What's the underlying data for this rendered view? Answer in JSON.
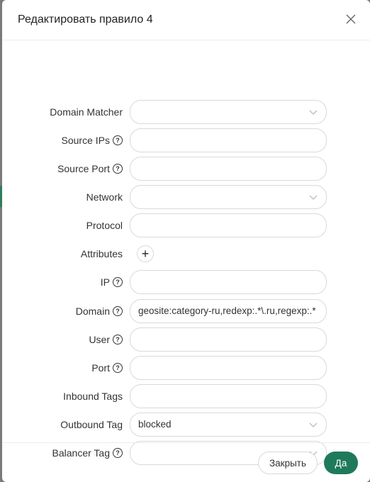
{
  "dialog": {
    "title": "Редактировать правило 4"
  },
  "fields": {
    "domain_matcher": {
      "label": "Domain Matcher",
      "value": ""
    },
    "source_ips": {
      "label": "Source IPs",
      "value": ""
    },
    "source_port": {
      "label": "Source Port",
      "value": ""
    },
    "network": {
      "label": "Network",
      "value": ""
    },
    "protocol": {
      "label": "Protocol",
      "value": ""
    },
    "attributes": {
      "label": "Attributes",
      "add_symbol": "+"
    },
    "ip": {
      "label": "IP",
      "value": ""
    },
    "domain": {
      "label": "Domain",
      "value": "geosite:category-ru,redexp:.*\\.ru,regexp:.*"
    },
    "user": {
      "label": "User",
      "value": ""
    },
    "port": {
      "label": "Port",
      "value": ""
    },
    "inbound_tags": {
      "label": "Inbound Tags",
      "value": ""
    },
    "outbound_tag": {
      "label": "Outbound Tag",
      "value": "blocked"
    },
    "balancer_tag": {
      "label": "Balancer Tag",
      "value": ""
    }
  },
  "footer": {
    "cancel_label": "Закрыть",
    "ok_label": "Да"
  },
  "colors": {
    "primary": "#1f7a5c",
    "border": "#d9d9d9"
  },
  "icons": {
    "close": "close-icon",
    "chevron": "chevron-down-icon",
    "help": "question-circle-icon",
    "add": "plus-icon"
  }
}
